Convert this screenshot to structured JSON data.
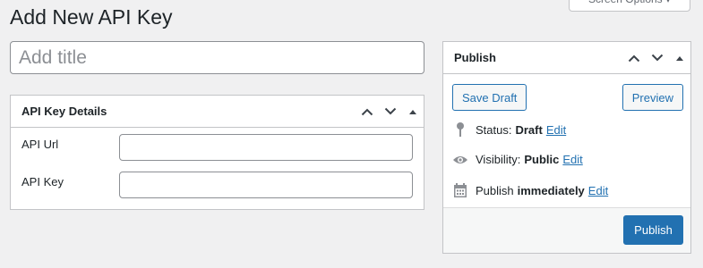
{
  "screen_options_label": "Screen Options ▾",
  "page_title": "Add New API Key",
  "title_field": {
    "placeholder": "Add title",
    "value": ""
  },
  "api_box": {
    "title": "API Key Details",
    "fields": [
      {
        "label": "API Url",
        "value": ""
      },
      {
        "label": "API Key",
        "value": ""
      }
    ]
  },
  "publish_box": {
    "title": "Publish",
    "save_draft_label": "Save Draft",
    "preview_label": "Preview",
    "status": {
      "label": "Status:",
      "value": "Draft",
      "edit_label": "Edit"
    },
    "visibility": {
      "label": "Visibility:",
      "value": "Public",
      "edit_label": "Edit"
    },
    "schedule": {
      "label": "Publish",
      "value": "immediately",
      "edit_label": "Edit"
    },
    "publish_label": "Publish"
  },
  "colors": {
    "accent": "#2271b1",
    "background": "#f0f0f1",
    "border": "#c3c4c7"
  },
  "icons": [
    "chevron-up-icon",
    "chevron-down-icon",
    "triangle-up-icon",
    "pin-icon",
    "eye-icon",
    "calendar-icon"
  ]
}
